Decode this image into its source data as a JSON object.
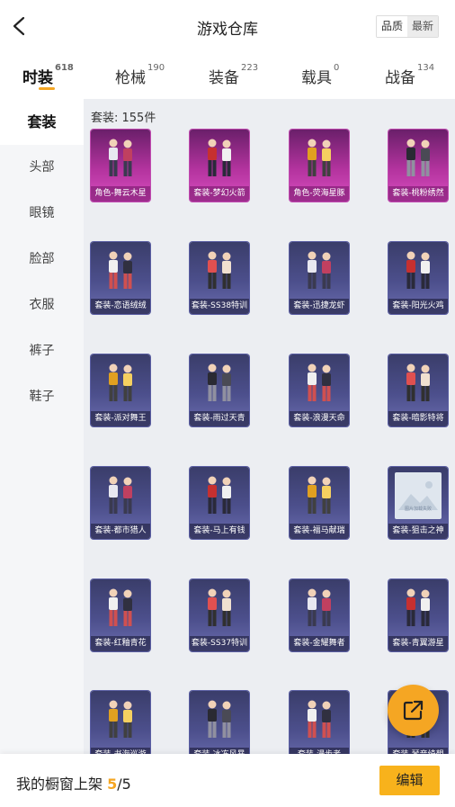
{
  "header": {
    "title": "游戏仓库",
    "sort": [
      "品质",
      "最新"
    ]
  },
  "tabs": [
    {
      "label": "时装",
      "count": "618"
    },
    {
      "label": "枪械",
      "count": "190"
    },
    {
      "label": "装备",
      "count": "223"
    },
    {
      "label": "载具",
      "count": "0"
    },
    {
      "label": "战备",
      "count": "134"
    }
  ],
  "sidebar": [
    "套装",
    "头部",
    "眼镜",
    "脸部",
    "衣服",
    "裤子",
    "鞋子"
  ],
  "content": {
    "count_label": "套装: 155件",
    "items": [
      {
        "label": "角色-舞云木星",
        "rarity": "pink"
      },
      {
        "label": "套装-梦幻火箭",
        "rarity": "pink"
      },
      {
        "label": "角色-荧海星豚",
        "rarity": "pink"
      },
      {
        "label": "套装-桃粉绣然",
        "rarity": "pink"
      },
      {
        "label": "套装-恋语绒绒",
        "rarity": "purple"
      },
      {
        "label": "套装-SS38特训",
        "rarity": "purple"
      },
      {
        "label": "套装-迅捷龙虾",
        "rarity": "purple"
      },
      {
        "label": "套装-阳光火鸡",
        "rarity": "purple"
      },
      {
        "label": "套装-派对舞王",
        "rarity": "purple"
      },
      {
        "label": "套装-雨过天青",
        "rarity": "purple"
      },
      {
        "label": "套装-浪漫天命",
        "rarity": "purple"
      },
      {
        "label": "套装-暗影特将",
        "rarity": "purple"
      },
      {
        "label": "套装-都市猎人",
        "rarity": "purple"
      },
      {
        "label": "套装-马上有钱",
        "rarity": "purple"
      },
      {
        "label": "套装-福马献瑞",
        "rarity": "purple"
      },
      {
        "label": "套装-狙击之神",
        "rarity": "purple",
        "placeholder": "图片加载失败"
      },
      {
        "label": "套装-红釉青花",
        "rarity": "purple"
      },
      {
        "label": "套装-SS37特训",
        "rarity": "purple"
      },
      {
        "label": "套装-金耀舞者",
        "rarity": "purple"
      },
      {
        "label": "套装-青翼游星",
        "rarity": "purple"
      },
      {
        "label": "套装-书海巡游",
        "rarity": "purple"
      },
      {
        "label": "套装-冰冻风暴",
        "rarity": "purple"
      },
      {
        "label": "套装-漫步者",
        "rarity": "purple"
      },
      {
        "label": "套装-琴音绮想",
        "rarity": "purple"
      }
    ]
  },
  "bottom": {
    "shelf_label": "我的橱窗上架",
    "shelf_current": "5",
    "shelf_total": "/5",
    "edit_label": "编辑"
  },
  "colors": {
    "accent": "#f5a623",
    "pink_card": "#b3339e",
    "purple_card": "#4c4f8c"
  },
  "icons": [
    "back-arrow-icon",
    "share-icon"
  ]
}
